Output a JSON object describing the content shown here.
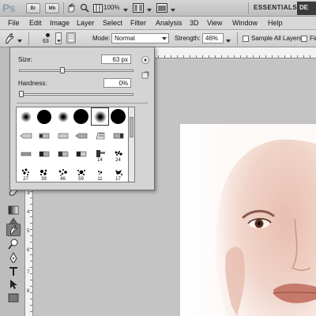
{
  "app": {
    "logo": "Ps",
    "bridge": "Br",
    "minibridge": "Mb",
    "zoom": "100%",
    "workspace": "ESSENTIALS",
    "workspace_next": "DE"
  },
  "menu": [
    "File",
    "Edit",
    "Image",
    "Layer",
    "Select",
    "Filter",
    "Analysis",
    "3D",
    "View",
    "Window",
    "Help"
  ],
  "options": {
    "brush_size": "63",
    "mode_label": "Mode:",
    "mode_value": "Normal",
    "strength_label": "Strength:",
    "strength_value": "46%",
    "sample_all_layers": "Sample All Layers",
    "finger_painting": "Fir"
  },
  "brush_picker": {
    "size_label": "Size:",
    "size_value": "63 px",
    "size_fraction": 0.38,
    "hardness_label": "Hardness:",
    "hardness_value": "0%",
    "hardness_fraction": 0.0,
    "brush_numbers": [
      "14",
      "24",
      "27",
      "39",
      "46",
      "59",
      "11",
      "17"
    ]
  },
  "ruler": {
    "marks": [
      "3",
      "4",
      "5",
      "6",
      "7",
      "8"
    ]
  },
  "colors": {
    "accent_dark": "#3a3a3a",
    "panel": "#d4d4d4",
    "skin": "#e9c6bb"
  },
  "icons": [
    "finger-smudge-icon",
    "bridge-icon",
    "minibridge-icon",
    "hand-icon",
    "zoom-icon",
    "move-icon",
    "gradient-icon",
    "pen-icon",
    "type-icon",
    "path-select-icon",
    "rectangle-icon",
    "menu-arrow-icon",
    "new-preset-icon"
  ]
}
